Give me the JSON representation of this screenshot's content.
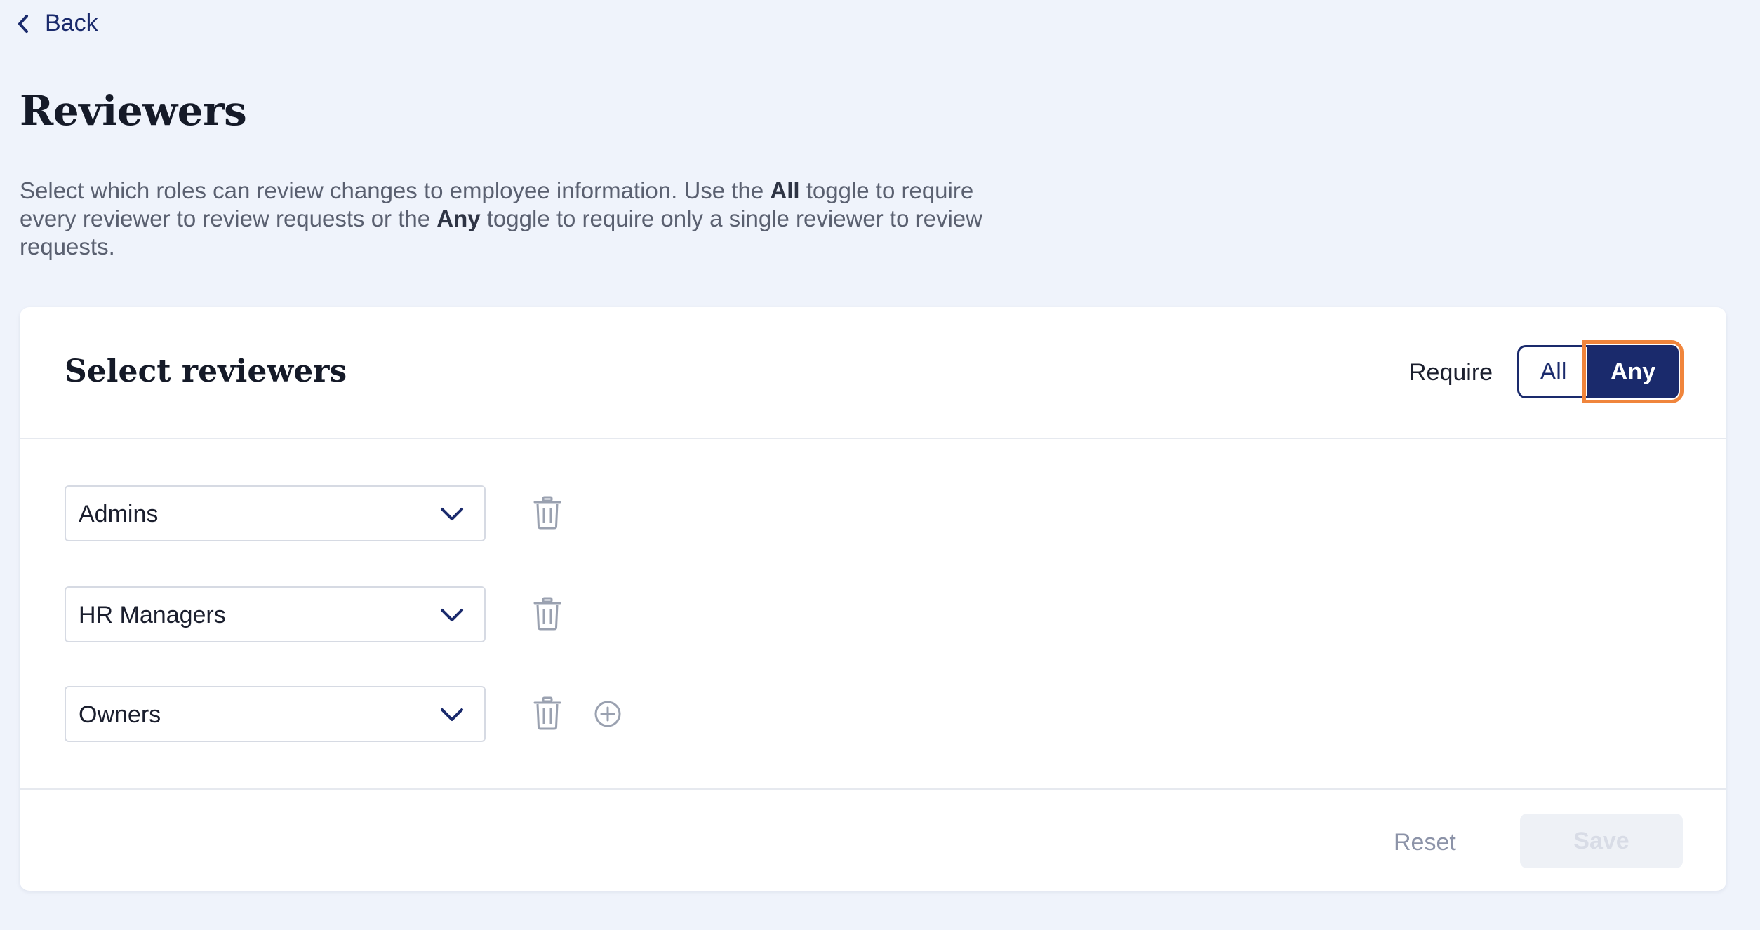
{
  "nav": {
    "back_label": "Back",
    "back_icon": "chevron-left-icon"
  },
  "page": {
    "title": "Reviewers",
    "description_part1": "Select which roles can review changes to employee information. Use the ",
    "description_bold1": "All",
    "description_part2": " toggle to require every reviewer to review requests or the ",
    "description_bold2": "Any",
    "description_part3": " toggle to require only a single reviewer to review requests."
  },
  "card": {
    "title": "Select reviewers",
    "require_label": "Require",
    "toggle": {
      "options": [
        "All",
        "Any"
      ],
      "all_label": "All",
      "any_label": "Any",
      "selected": "Any"
    },
    "reviewers": [
      {
        "role": "Admins"
      },
      {
        "role": "HR Managers"
      },
      {
        "role": "Owners"
      }
    ],
    "footer": {
      "reset_label": "Reset",
      "save_label": "Save",
      "save_enabled": false
    }
  },
  "colors": {
    "background": "#eff3fb",
    "primary": "#1a2a6c",
    "focus_outline": "#f0853c",
    "muted_text": "#8c93a8",
    "icon_gray": "#9aa1b0"
  }
}
